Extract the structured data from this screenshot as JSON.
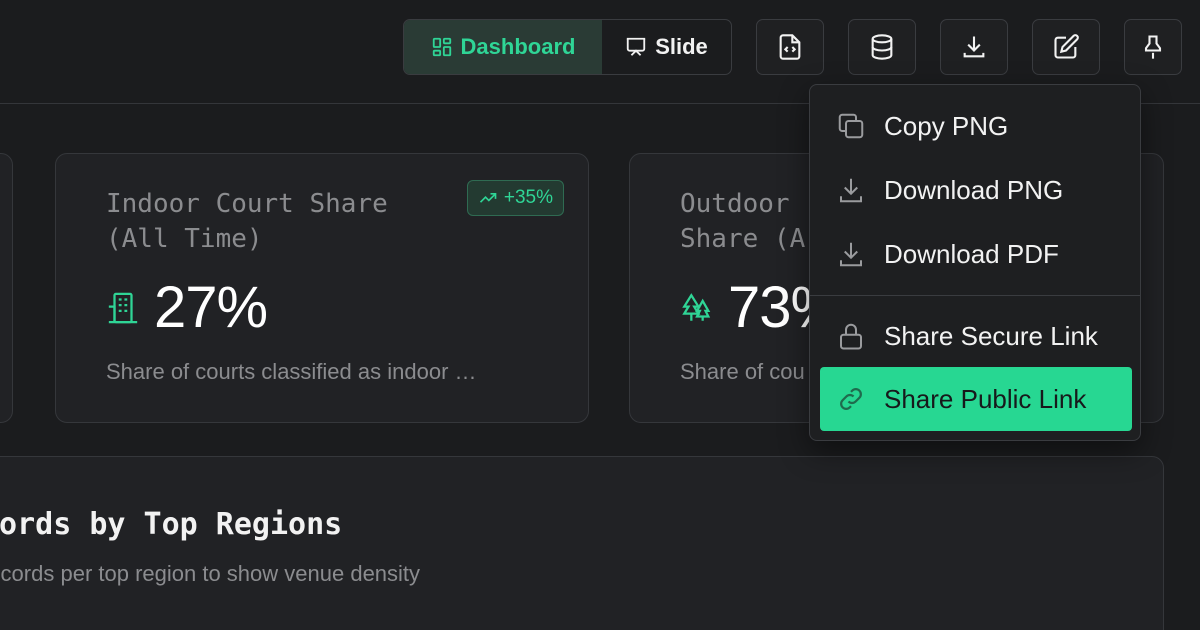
{
  "colors": {
    "accent": "#2fd596",
    "highlight": "#27d792",
    "background": "#1b1c1e",
    "card": "#212225"
  },
  "toolbar": {
    "view_toggle": {
      "dashboard_label": "Dashboard",
      "slide_label": "Slide",
      "selected": "Dashboard"
    },
    "icons": [
      "code-file-icon",
      "database-icon",
      "download-icon",
      "edit-icon",
      "pin-icon"
    ]
  },
  "cards": {
    "indoor": {
      "title": "Indoor Court Share (All Time)",
      "badge": "+35%",
      "value": "27%",
      "description": "Share of courts classified as indoor …",
      "icon": "building-icon"
    },
    "outdoor": {
      "title_line1": "Outdoor",
      "title_line2": "Share (A",
      "value": "73%",
      "description": "Share of cou",
      "icon": "trees-icon"
    }
  },
  "panel": {
    "title": "cords by Top Regions",
    "subtitle": "records per top region to show venue density"
  },
  "menu": {
    "items": [
      {
        "label": "Copy PNG",
        "icon": "copy-icon"
      },
      {
        "label": "Download PNG",
        "icon": "download-icon"
      },
      {
        "label": "Download PDF",
        "icon": "download-icon"
      },
      {
        "label": "Share Secure Link",
        "icon": "lock-icon"
      },
      {
        "label": "Share Public Link",
        "icon": "link-icon",
        "highlighted": true
      }
    ]
  }
}
